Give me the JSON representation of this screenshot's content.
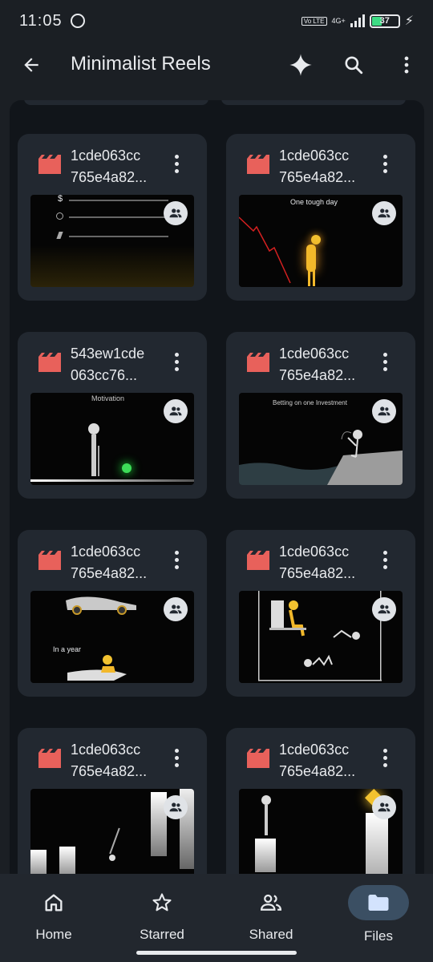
{
  "status_bar": {
    "time": "11:05",
    "network_volte": "Vo LTE",
    "network_type": "4G+",
    "battery": "37"
  },
  "app_bar": {
    "title": "Minimalist Reels"
  },
  "icons": {
    "back": "arrow-left-icon",
    "gemini": "sparkle-icon",
    "search": "search-icon",
    "more": "more-vertical-icon",
    "file_type": "video-file-icon",
    "shared": "people-icon"
  },
  "files": [
    {
      "name_line1": "1cde063cc",
      "name_line2": "765e4a82...",
      "thumb_text": ""
    },
    {
      "name_line1": "1cde063cc",
      "name_line2": "765e4a82...",
      "thumb_text": "One tough day"
    },
    {
      "name_line1": "543ew1cde",
      "name_line2": "063cc76...",
      "thumb_text": "Motivation"
    },
    {
      "name_line1": "1cde063cc",
      "name_line2": "765e4a82...",
      "thumb_text": "Betting on one Investment"
    },
    {
      "name_line1": "1cde063cc",
      "name_line2": "765e4a82...",
      "thumb_text": "In a year"
    },
    {
      "name_line1": "1cde063cc",
      "name_line2": "765e4a82...",
      "thumb_text": ""
    },
    {
      "name_line1": "1cde063cc",
      "name_line2": "765e4a82...",
      "thumb_text": ""
    },
    {
      "name_line1": "1cde063cc",
      "name_line2": "765e4a82...",
      "thumb_text": ""
    }
  ],
  "thumb1_symbols": [
    "$"
  ],
  "bottom_nav": {
    "items": [
      {
        "label": "Home",
        "icon": "home-icon"
      },
      {
        "label": "Starred",
        "icon": "star-icon"
      },
      {
        "label": "Shared",
        "icon": "people-icon"
      },
      {
        "label": "Files",
        "icon": "folder-icon",
        "active": true
      }
    ]
  },
  "colors": {
    "background": "#1b1f24",
    "card": "#222830",
    "video_icon": "#e8615b",
    "nav_active": "#3b4f63",
    "battery_fill": "#3ddc84"
  }
}
